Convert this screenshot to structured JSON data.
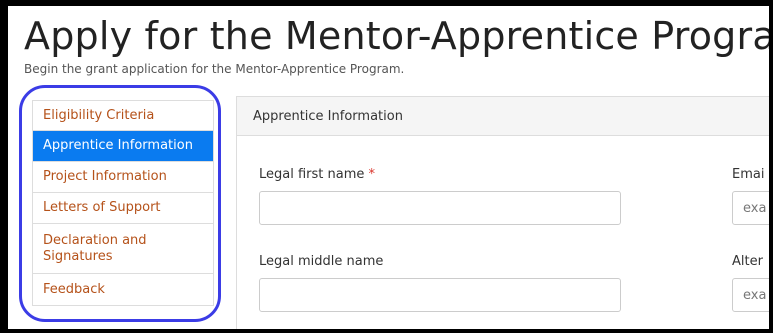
{
  "page": {
    "title": "Apply for the Mentor-Apprentice Program",
    "subtitle": "Begin the grant application for the Mentor-Apprentice Program."
  },
  "sidebar": {
    "items": [
      {
        "label": "Eligibility Criteria",
        "active": false
      },
      {
        "label": "Apprentice Information",
        "active": true
      },
      {
        "label": "Project Information",
        "active": false
      },
      {
        "label": "Letters of Support",
        "active": false
      },
      {
        "label": "Declaration and Signatures",
        "active": false
      },
      {
        "label": "Feedback",
        "active": false
      }
    ]
  },
  "panel": {
    "header": "Apprentice Information",
    "fields": {
      "legal_first_name": {
        "label": "Legal first name",
        "required_mark": "*",
        "value": ""
      },
      "legal_middle_name": {
        "label": "Legal middle name",
        "value": ""
      },
      "email": {
        "label": "Emai",
        "placeholder": "exa"
      },
      "alternate": {
        "label": "Alter",
        "placeholder": "exa"
      }
    }
  },
  "colors": {
    "active_nav": "#0a7bf0",
    "nav_link": "#b5521a",
    "annotation_oval": "#3b3ce6",
    "required": "#d9342b"
  }
}
